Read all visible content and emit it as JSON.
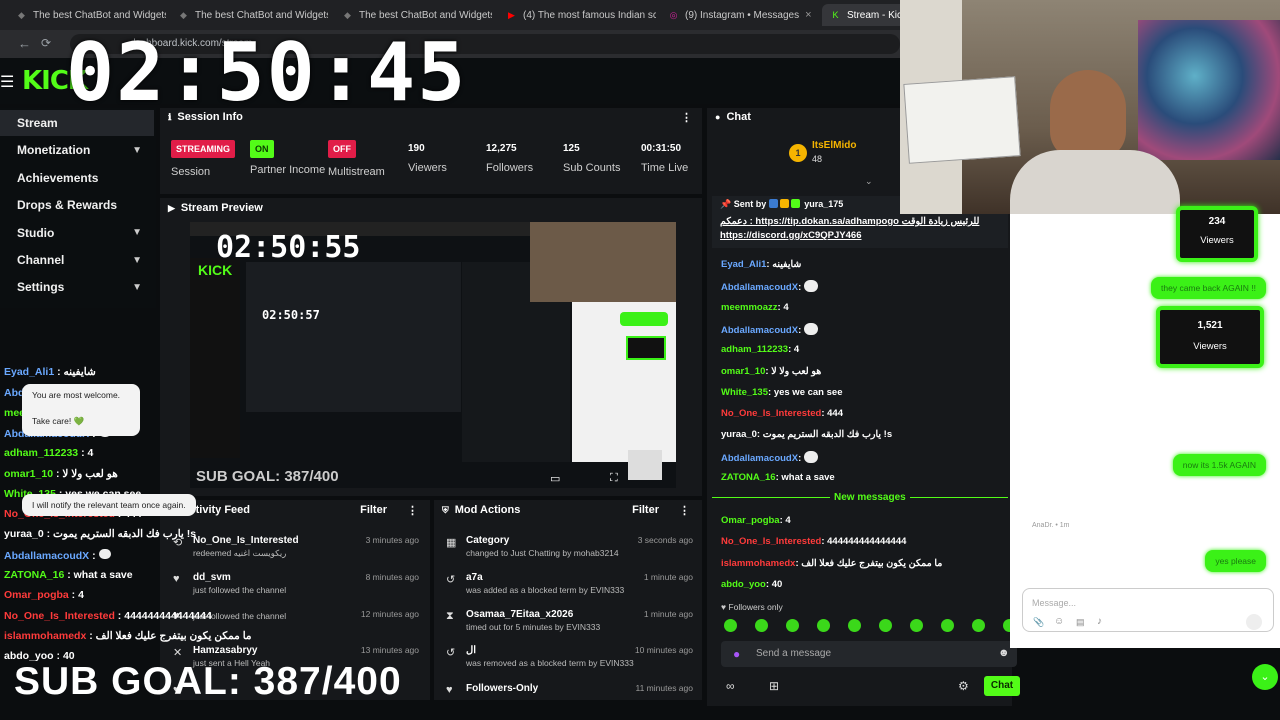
{
  "tabs": [
    {
      "title": "The best ChatBot and Widgets",
      "icon": "diamond",
      "color": "#777"
    },
    {
      "title": "The best ChatBot and Widgets",
      "icon": "diamond",
      "color": "#777"
    },
    {
      "title": "The best ChatBot and Widgets",
      "icon": "diamond",
      "color": "#777"
    },
    {
      "title": "(4) The most famous Indian sc",
      "icon": "youtube",
      "color": "#ff0000"
    },
    {
      "title": "(9) Instagram • Messages",
      "icon": "instagram",
      "color": "#d6249f"
    },
    {
      "title": "Stream - Kick",
      "icon": "kick",
      "color": "#53fc18"
    }
  ],
  "url": "dashboard.kick.com/stream",
  "logo": "KICK",
  "timer": "02:50:45",
  "sidebar": {
    "items": [
      {
        "label": "Stream",
        "active": true,
        "chevron": false
      },
      {
        "label": "Monetization",
        "chevron": true
      },
      {
        "label": "Achievements",
        "chevron": false
      },
      {
        "label": "Drops & Rewards",
        "chevron": false
      },
      {
        "label": "Studio",
        "chevron": true
      },
      {
        "label": "Channel",
        "chevron": true
      },
      {
        "label": "Settings",
        "chevron": true
      }
    ]
  },
  "session": {
    "title": "Session Info",
    "session_badge": "STREAMING",
    "session_label": "Session",
    "partner_badge": "ON",
    "partner_label": "Partner Income",
    "multi_badge": "OFF",
    "multi_label": "Multistream",
    "viewers": "190",
    "viewers_label": "Viewers",
    "followers": "12,275",
    "followers_label": "Followers",
    "subs": "125",
    "subs_label": "Sub Counts",
    "time": "00:31:50",
    "time_label": "Time Live"
  },
  "preview": {
    "title": "Stream Preview",
    "timer": "02:50:55",
    "inner_timer": "02:50:57",
    "subgoal": "SUB GOAL: 387/400"
  },
  "activity": {
    "title": "Activity Feed",
    "filter": "Filter",
    "items": [
      {
        "name": "No_One_Is_Interested",
        "sub": "redeemed ريكويست اغنيه",
        "time": "3 minutes ago",
        "icon": "reward"
      },
      {
        "name": "dd_svm",
        "sub": "just followed the channel",
        "time": "8 minutes ago",
        "icon": "heart"
      },
      {
        "name": "",
        "sub": "just followed the channel",
        "time": "12 minutes ago",
        "icon": "heart"
      },
      {
        "name": "Hamzasabryy",
        "sub": "just sent a Hell Yeah",
        "time": "13 minutes ago",
        "icon": "close"
      },
      {
        "name": "",
        "sub": "",
        "time": "",
        "icon": "heart"
      }
    ]
  },
  "mod": {
    "title": "Mod Actions",
    "filter": "Filter",
    "items": [
      {
        "name": "Category",
        "sub": "changed to Just Chatting by mohab3214",
        "time": "3 seconds ago",
        "icon": "category"
      },
      {
        "name": "a7a",
        "sub": "was added as a blocked term by EVIN333",
        "time": "1 minute ago",
        "icon": "undo"
      },
      {
        "name": "Osamaa_7Eitaa_x2026",
        "sub": "timed out for 5 minutes by EVIN333",
        "time": "1 minute ago",
        "icon": "hourglass"
      },
      {
        "name": "ال",
        "sub": "was removed as a blocked term by EVIN333",
        "time": "10 minutes ago",
        "icon": "undo"
      },
      {
        "name": "Followers-Only",
        "sub": "",
        "time": "11 minutes ago",
        "icon": "heart"
      }
    ]
  },
  "chat": {
    "title": "Chat",
    "pinned_user": "ItsElMido",
    "pinned_count": "48",
    "sent_by": "Sent by",
    "sent_user": "yura_175",
    "pinned_text1": "دعمكم : https://tip.dokan.sa/adhampogo للرئيس زيادة الوقت",
    "pinned_text2": "https://discord.gg/xC9QPJY466",
    "messages": [
      {
        "user": "Eyad_Ali1",
        "text": "شايفينه",
        "ucolor": "#6aa8ff"
      },
      {
        "user": "AbdallamacoudX",
        "text": "",
        "ucolor": "#6aa8ff"
      },
      {
        "user": "meemmoazz",
        "text": "4",
        "ucolor": "#53fc18"
      },
      {
        "user": "AbdallamacoudX",
        "text": "",
        "ucolor": "#6aa8ff"
      },
      {
        "user": "adham_112233",
        "text": "4",
        "ucolor": "#53fc18"
      },
      {
        "user": "omar1_10",
        "text": "هو لعب ولا لا",
        "ucolor": "#53fc18"
      },
      {
        "user": "White_135",
        "text": "yes we can see",
        "ucolor": "#53fc18"
      },
      {
        "user": "No_One_Is_Interested",
        "text": "444",
        "ucolor": "#ff3b3b"
      },
      {
        "user": "yuraa_0",
        "text": "يارب فك الدبقه الستريم يموت !s",
        "ucolor": "#fff"
      },
      {
        "user": "AbdallamacoudX",
        "text": "",
        "ucolor": "#6aa8ff"
      },
      {
        "user": "ZATONA_16",
        "text": "what a save",
        "ucolor": "#53fc18"
      }
    ],
    "new_messages": "New messages",
    "messages2": [
      {
        "user": "Omar_pogba",
        "text": "4",
        "ucolor": "#53fc18"
      },
      {
        "user": "No_One_Is_Interested",
        "text": "444444444444444",
        "ucolor": "#ff3b3b"
      },
      {
        "user": "islammohamedx",
        "text": "ما ممكن يكون بيتفرج عليك فعلا الف",
        "ucolor": "#ff3b3b"
      },
      {
        "user": "abdo_yoo",
        "text": "40",
        "ucolor": "#53fc18"
      }
    ],
    "followers_only": "Followers only",
    "input_placeholder": "Send a message",
    "chat_button": "Chat"
  },
  "left_chat": [
    {
      "user": "Eyad_Ali1",
      "text": "شايفينه",
      "ucolor": "#6aa8ff"
    },
    {
      "user": "AbdallamacoudX",
      "text": "",
      "ucolor": "#6aa8ff"
    },
    {
      "user": "meemmoazz",
      "text": "4",
      "ucolor": "#53fc18"
    },
    {
      "user": "AbdallamacoudX",
      "text": "",
      "ucolor": "#6aa8ff"
    },
    {
      "user": "adham_112233",
      "text": "4",
      "ucolor": "#53fc18"
    },
    {
      "user": "omar1_10",
      "text": "هو لعب ولا لا",
      "ucolor": "#53fc18"
    },
    {
      "user": "White_135",
      "text": "yes we can see",
      "ucolor": "#53fc18"
    },
    {
      "user": "No_One_Is_Interested",
      "text": "444",
      "ucolor": "#ff3b3b"
    },
    {
      "user": "yuraa_0",
      "text": "يارب فك الدبقه الستريم يموت !s",
      "ucolor": "#fff"
    },
    {
      "user": "AbdallamacoudX",
      "text": "",
      "ucolor": "#6aa8ff"
    },
    {
      "user": "ZATONA_16",
      "text": "what a save",
      "ucolor": "#53fc18"
    },
    {
      "user": "Omar_pogba",
      "text": "4",
      "ucolor": "#ff3b3b"
    },
    {
      "user": "No_One_Is_Interested",
      "text": "444444444444444",
      "ucolor": "#ff3b3b"
    },
    {
      "user": "islammohamedx",
      "text": "ما ممكن يكون بيتفرج عليك فعلا الف",
      "ucolor": "#ff3b3b"
    },
    {
      "user": "abdo_yoo",
      "text": "40",
      "ucolor": "#fff"
    }
  ],
  "subgoal": "SUB GOAL: 387/400",
  "messenger": {
    "viewers1": "234",
    "viewers1_label": "Viewers",
    "msg1": "they came back AGAIN !!",
    "viewers2": "1,521",
    "viewers2_label": "Viewers",
    "reply1a": "You are most welcome.",
    "reply1b": "Take care! 💚",
    "msg2": "now its 1.5k AGAIN",
    "reply2": "I will notify the relevant team once again.",
    "reply2_meta": "AnaDr. • 1m",
    "msg3": "yes please",
    "placeholder": "Message..."
  },
  "colors": {
    "accent": "#53fc18",
    "danger": "#e11d48"
  }
}
